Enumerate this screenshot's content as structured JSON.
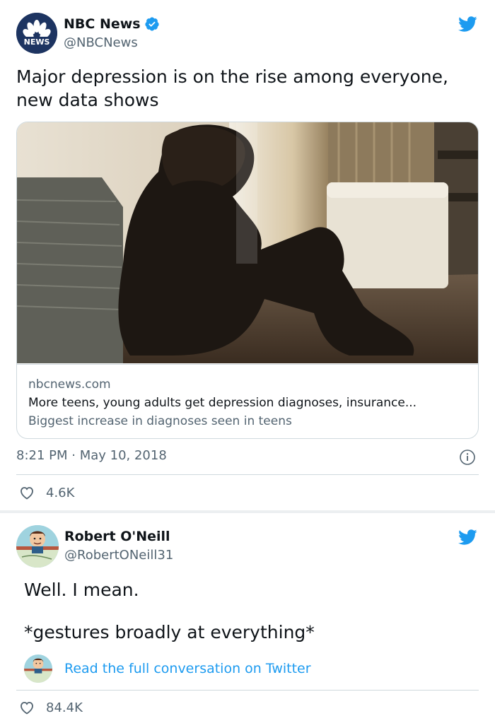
{
  "tweet1": {
    "author_name": "NBC News",
    "author_handle": "@NBCNews",
    "avatar_badge_text": "NEWS",
    "text_lines": [
      "Major depression is on the rise among everyone,",
      "new data shows"
    ],
    "card": {
      "domain": "nbcnews.com",
      "title": "More teens, young adults get depression diagnoses, insurance...",
      "description": "Biggest increase in diagnoses seen in teens"
    },
    "timestamp": "8:21 PM · May 10, 2018",
    "like_count": "4.6K"
  },
  "tweet2": {
    "author_name": "Robert O'Neill",
    "author_handle": "@RobertONeill31",
    "text_line1": "Well. I mean.",
    "text_line2": "*gestures broadly at everything*",
    "conversation_link": "Read the full conversation on Twitter",
    "like_count": "84.4K"
  },
  "colors": {
    "twitter_blue": "#1d9bf0",
    "secondary_text": "#536471",
    "primary_text": "#0f1419",
    "border": "#cfd9de"
  },
  "icons": [
    "twitter-bird-icon",
    "verified-badge-icon",
    "info-icon",
    "heart-icon",
    "nbc-peacock-icon"
  ]
}
